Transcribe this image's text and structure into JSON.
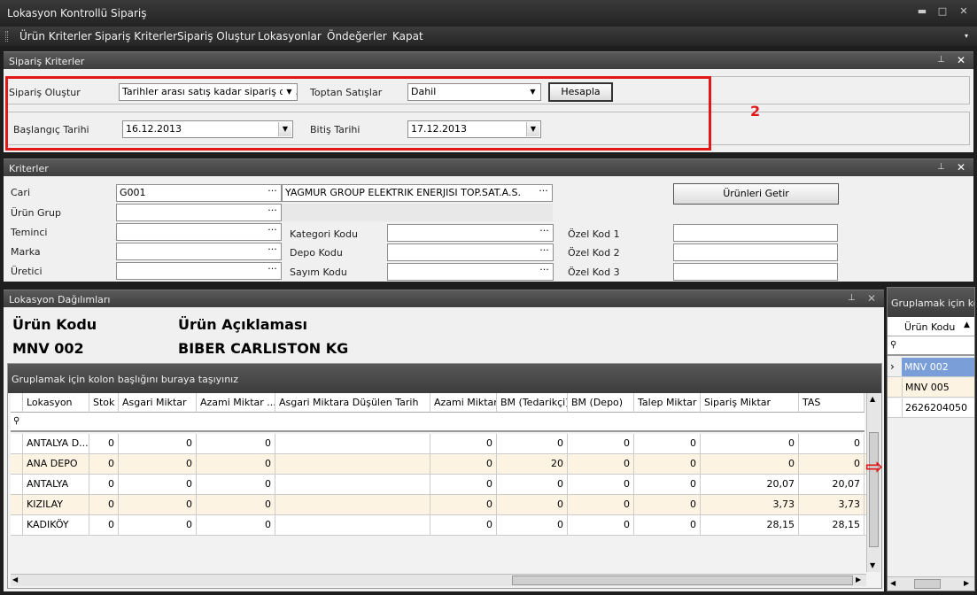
{
  "window": {
    "title": "Lokasyon Kontrollü Sipariş",
    "minimize": "▬",
    "maximize": "□",
    "close": "✕"
  },
  "menu": [
    "Ürün Kriterler",
    "Sipariş Kriterler",
    "Sipariş Oluştur",
    "Lokasyonlar",
    "Öndeğerler",
    "Kapat"
  ],
  "siparis_kriterler": {
    "title": "Sipariş Kriterler",
    "siparis_olustur_label": "Sipariş Oluştur",
    "siparis_olustur_value": "Tarihler arası satış kadar sipariş olu...",
    "toptan_label": "Toptan Satışlar",
    "toptan_value": "Dahil",
    "hesapla": "Hesapla",
    "baslangic_label": "Başlangıç Tarihi",
    "baslangic_value": "16.12.2013",
    "bitis_label": "Bitiş Tarihi",
    "bitis_value": "17.12.2013",
    "annotation": "2"
  },
  "kriterler": {
    "title": "Kriterler",
    "cari_label": "Cari",
    "cari_value": "G001",
    "cari_name": "YAGMUR GROUP ELEKTRIK ENERJISI TOP.SAT.A.S.",
    "urun_grup_label": "Ürün Grup",
    "temin_label": "Teminci",
    "marka_label": "Marka",
    "uretici_label": "Üretici",
    "kategori_label": "Kategori Kodu",
    "depo_label": "Depo Kodu",
    "sayim_label": "Sayım Kodu",
    "ozel1": "Özel Kod 1",
    "ozel2": "Özel Kod 2",
    "ozel3": "Özel Kod 3",
    "urunleri_getir": "Ürünleri Getir"
  },
  "lokasyon": {
    "title": "Lokasyon Dağılımları",
    "urun_kodu_label": "Ürün Kodu",
    "urun_aciklama_label": "Ürün Açıklaması",
    "urun_kodu": "MNV 002",
    "urun_aciklama": "BIBER CARLISTON KG",
    "group_hint": "Gruplamak için kolon başlığını buraya taşıyınız",
    "columns": [
      "Lokasyon",
      "Stok",
      "Asgari Miktar",
      "Azami Miktar ...",
      "Asgari Miktara Düşülen Tarih",
      "Azami Miktar",
      "BM (Tedarikçi)",
      "BM (Depo)",
      "Talep Miktar",
      "Sipariş Miktar",
      "TAS"
    ],
    "rows": [
      [
        "ANTALYA D...",
        "0",
        "0",
        "0",
        "",
        "0",
        "0",
        "0",
        "0",
        "0",
        "0"
      ],
      [
        "ANA DEPO",
        "0",
        "0",
        "0",
        "",
        "0",
        "20",
        "0",
        "0",
        "0",
        "0"
      ],
      [
        "ANTALYA",
        "0",
        "0",
        "0",
        "",
        "0",
        "0",
        "0",
        "0",
        "20,07",
        "20,07"
      ],
      [
        "KIZILAY",
        "0",
        "0",
        "0",
        "",
        "0",
        "0",
        "0",
        "0",
        "3,73",
        "3,73"
      ],
      [
        "KADIKÖY",
        "0",
        "0",
        "0",
        "",
        "0",
        "0",
        "0",
        "0",
        "28,15",
        "28,15"
      ]
    ]
  },
  "right_grid": {
    "group_hint": "Gruplamak için kolc",
    "column": "Ürün Kodu",
    "rows": [
      "MNV 002",
      "MNV 005",
      "2626204050"
    ]
  }
}
